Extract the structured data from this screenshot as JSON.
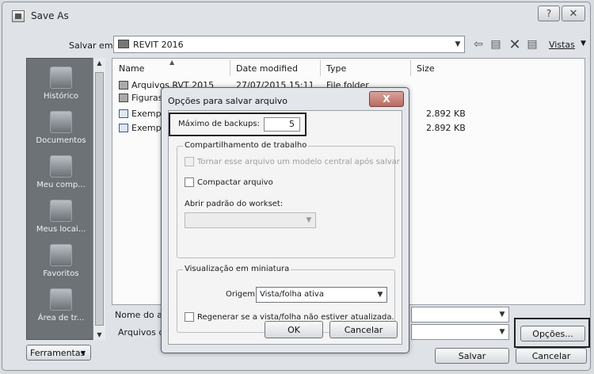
{
  "window": {
    "title": "Save As",
    "help_label": "?",
    "close_label": "✕"
  },
  "toolbar": {
    "save_in_label": "Salvar em:",
    "current_folder": "REVIT 2016",
    "views_label": "Vistas"
  },
  "places": [
    {
      "label": "Histórico",
      "icon": "history-icon"
    },
    {
      "label": "Documentos",
      "icon": "documents-icon"
    },
    {
      "label": "Meu comp...",
      "icon": "computer-icon"
    },
    {
      "label": "Meus locai...",
      "icon": "network-icon"
    },
    {
      "label": "Favoritos",
      "icon": "favorites-icon"
    },
    {
      "label": "Área de tr...",
      "icon": "desktop-icon"
    }
  ],
  "filelist": {
    "columns": [
      "Name",
      "Date modified",
      "Type",
      "Size"
    ],
    "rows": [
      {
        "name": "Arquivos RVT 2015",
        "date": "27/07/2015 15:11",
        "type": "File folder",
        "size": "",
        "icon": "folder"
      },
      {
        "name": "Figuras",
        "date": "",
        "type": "",
        "size": "",
        "icon": "folder"
      },
      {
        "name": "Exempl",
        "date": "",
        "type": "",
        "size": "2.892 KB",
        "icon": "rvt"
      },
      {
        "name": "Exempl",
        "date": "",
        "type": "",
        "size": "2.892 KB",
        "icon": "rvt"
      }
    ]
  },
  "bottom": {
    "filename_label": "Nome do arq",
    "filetype_label": "Arquivos do",
    "options_label": "Opções...",
    "tools_label": "Ferramentas",
    "save_label": "Salvar",
    "cancel_label": "Cancelar"
  },
  "dialog": {
    "title": "Opções para salvar arquivo",
    "close_label": "X",
    "max_backups_label": "Máximo de backups:",
    "max_backups_value": "5",
    "worksharing_title": "Compartilhamento de trabalho",
    "make_central_label": "Tornar esse arquivo um modelo central após salvar",
    "compact_label": "Compactar arquivo",
    "open_workset_label": "Abrir padrão do workset:",
    "thumbnail_title": "Visualização em miniatura",
    "origin_label": "Origem:",
    "origin_value": "Vista/folha ativa",
    "regenerate_label": "Regenerar se a vista/folha não estiver atualizada.",
    "ok_label": "OK",
    "cancel_label": "Cancelar"
  }
}
